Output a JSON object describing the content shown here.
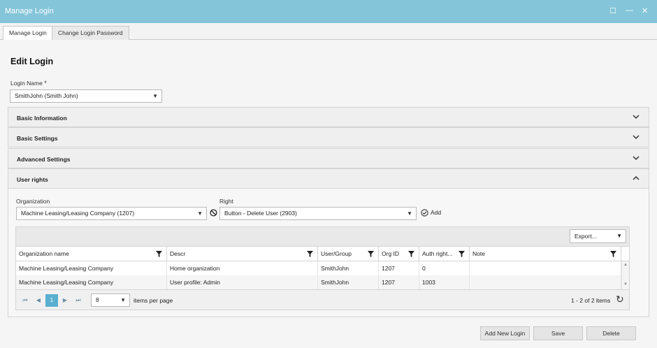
{
  "window": {
    "title": "Manage Login",
    "maximize_icon": "☐",
    "minimize_icon": "—",
    "close_icon": "✕"
  },
  "tabs": [
    {
      "label": "Manage Login"
    },
    {
      "label": "Change Login Password"
    }
  ],
  "form": {
    "heading": "Edit Login",
    "login_name_label": "Login Name",
    "required_mark": "*",
    "login_name_value": "SmithJohn (Smith John)"
  },
  "sections": [
    {
      "title": "Basic Information"
    },
    {
      "title": "Basic Settings"
    },
    {
      "title": "Advanced Settings"
    },
    {
      "title": "User rights"
    }
  ],
  "rights": {
    "organization_label": "Organization",
    "organization_value": "Machine Leasing/Leasing Company (1207)",
    "right_label": "Right",
    "right_value": "Button - Delete User (2903)",
    "add_label": "Add"
  },
  "grid": {
    "export_label": "Export...",
    "columns": [
      "Organization name",
      "Descr",
      "User/Group",
      "Org ID",
      "Auth right...",
      "Note"
    ],
    "rows": [
      [
        "Machine Leasing/Leasing Company",
        "Home organization",
        "SmithJohn",
        "1207",
        "0",
        ""
      ],
      [
        "Machine Leasing/Leasing Company",
        "User profile: Admin",
        "SmithJohn",
        "1207",
        "1003",
        ""
      ]
    ],
    "pager": {
      "first": "⏮",
      "prev": "◀",
      "current": "1",
      "next": "▶",
      "last": "⏭",
      "page_size": "8",
      "items_per_page": "items per page",
      "summary": "1 - 2 of 2 items",
      "refresh_icon": "↻"
    }
  },
  "buttons": {
    "add_new_login": "Add New Login",
    "save": "Save",
    "delete": "Delete"
  },
  "colors": {
    "titlebar": "#84c5d9",
    "pager_active": "#5aaed0"
  }
}
